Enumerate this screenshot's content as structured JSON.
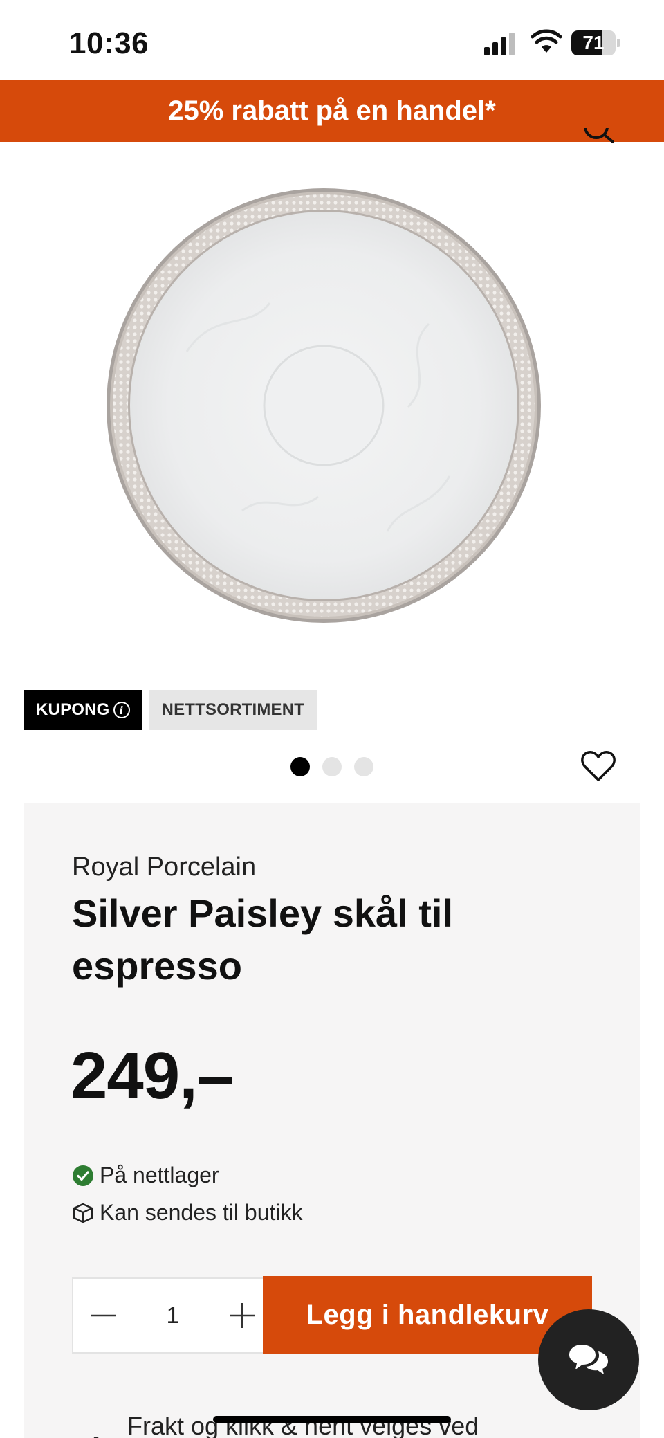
{
  "status_bar": {
    "time": "10:36",
    "battery_level": "71"
  },
  "promo": {
    "text": "25% rabatt på en handel*"
  },
  "badges": {
    "kupong": "KUPONG",
    "nettsortiment": "NETTSORTIMENT"
  },
  "gallery": {
    "image_count": 3,
    "active_index": 0
  },
  "product": {
    "brand": "Royal Porcelain",
    "title": "Silver Paisley skål til espresso",
    "price": "249,–"
  },
  "availability": {
    "online": "På nettlager",
    "store": "Kan sendes til butikk"
  },
  "purchase": {
    "quantity": "1",
    "add_to_cart_label": "Legg i handlekurv"
  },
  "shipping": {
    "text": "Frakt og klikk & hent velges ved"
  },
  "colors": {
    "brand_orange": "#d64a0b",
    "in_stock_green": "#2e7d32",
    "card_bg": "#f6f5f5"
  },
  "icons": [
    "signal-icon",
    "wifi-icon",
    "battery-icon",
    "search-icon",
    "info-icon",
    "heart-icon",
    "check-circle-icon",
    "box-icon",
    "minus-icon",
    "plus-icon",
    "truck-icon",
    "chat-icon"
  ]
}
